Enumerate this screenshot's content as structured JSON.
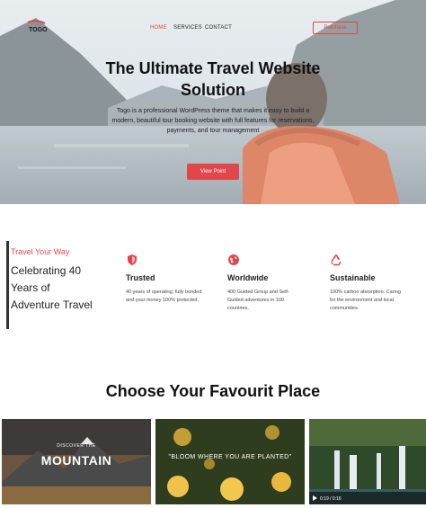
{
  "nav": {
    "items": [
      "HOME",
      "SERVICES",
      "CONTACT"
    ],
    "active": "HOME",
    "purchase_label": "Purchase"
  },
  "hero": {
    "title": "The Ultimate Travel Website Solution",
    "description": "Togo is a professional WordPress theme that makes it easy to build a modern, beautiful tour booking website with full features for reservations, payments, and tour management",
    "cta_label": "View Point"
  },
  "features": {
    "kicker": "Travel Your Way",
    "headline": "Celebrating 40 Years of Adventure Travel",
    "items": [
      {
        "icon": "shield-icon",
        "title": "Trusted",
        "text": "40 years of operating; fully bonded and your money 100% protected."
      },
      {
        "icon": "globe-icon",
        "title": "Worldwide",
        "text": "400 Guided Group and Self-Guided adventures in 100 countries."
      },
      {
        "icon": "recycle-icon",
        "title": "Sustainable",
        "text": "100% carbon absorption. Caring for the environment and local communities."
      }
    ]
  },
  "places": {
    "title": "Choose Your Favourit Place",
    "cards": [
      {
        "line1": "DISCOVER THE",
        "line2": "MOUNTAIN"
      },
      {
        "quote": "\"BLOOM WHERE YOU ARE PLANTED\""
      },
      {
        "video_time": "0:19 / 0:16"
      }
    ]
  },
  "colors": {
    "accent": "#e0464b",
    "text": "#222222"
  }
}
